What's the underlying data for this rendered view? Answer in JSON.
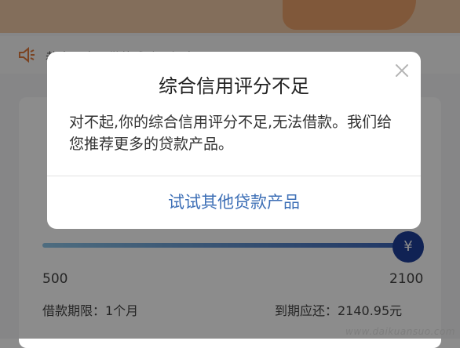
{
  "colors": {
    "accent": "#3d6fb6",
    "slider_start": "#8ec6e8",
    "slider_end": "#1e3f9a",
    "banner": "#efc8a6"
  },
  "background": {
    "notice_text": "恭喜用户...借款成功...额度...",
    "slider": {
      "min": "500",
      "max": "2100",
      "knob_symbol": "¥",
      "position_fraction": 1.0
    },
    "term": "借款期限：1个月",
    "due": "到期应还：2140.95元"
  },
  "dialog": {
    "title": "综合信用评分不足",
    "body": "对不起,你的综合信用评分不足,无法借款。我们给您推荐更多的贷款产品。",
    "action": "试试其他贷款产品"
  },
  "watermark": "www.daikuansuo.com",
  "icons": {
    "close": "close-icon",
    "speaker": "speaker-icon"
  }
}
